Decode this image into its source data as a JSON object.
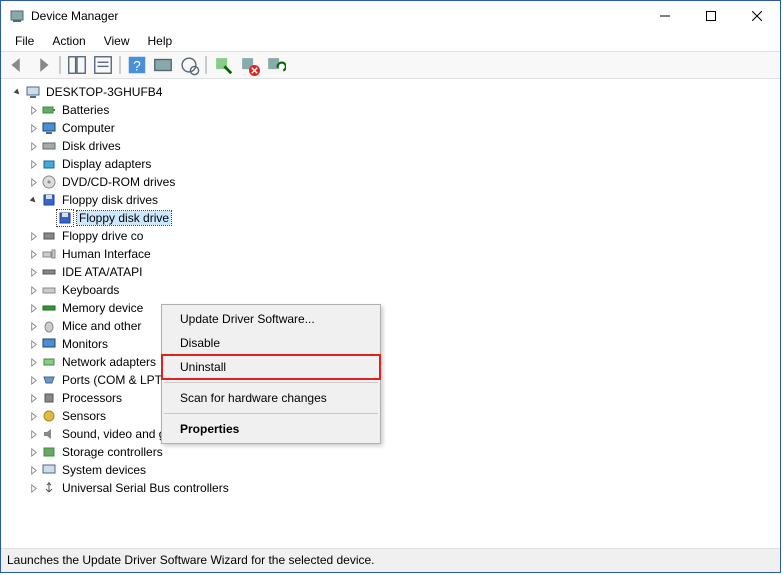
{
  "window": {
    "title": "Device Manager"
  },
  "menu": {
    "file": "File",
    "action": "Action",
    "view": "View",
    "help": "Help"
  },
  "root": "DESKTOP-3GHUFB4",
  "cats": {
    "batteries": "Batteries",
    "computer": "Computer",
    "disk": "Disk drives",
    "display": "Display adapters",
    "dvd": "DVD/CD-ROM drives",
    "floppy": "Floppy disk drives",
    "floppy_drive": "Floppy disk drive",
    "floppy_ctrl": "Floppy drive co",
    "hid": "Human Interface",
    "ide": "IDE ATA/ATAPI",
    "kbd": "Keyboards",
    "mem": "Memory device",
    "mice": "Mice and other",
    "mon": "Monitors",
    "net": "Network adapters",
    "ports": "Ports (COM & LPT)",
    "proc": "Processors",
    "sens": "Sensors",
    "sound": "Sound, video and game controllers",
    "stor": "Storage controllers",
    "sys": "System devices",
    "usb": "Universal Serial Bus controllers"
  },
  "ctx": {
    "update": "Update Driver Software...",
    "disable": "Disable",
    "uninstall": "Uninstall",
    "scan": "Scan for hardware changes",
    "props": "Properties"
  },
  "status": "Launches the Update Driver Software Wizard for the selected device."
}
